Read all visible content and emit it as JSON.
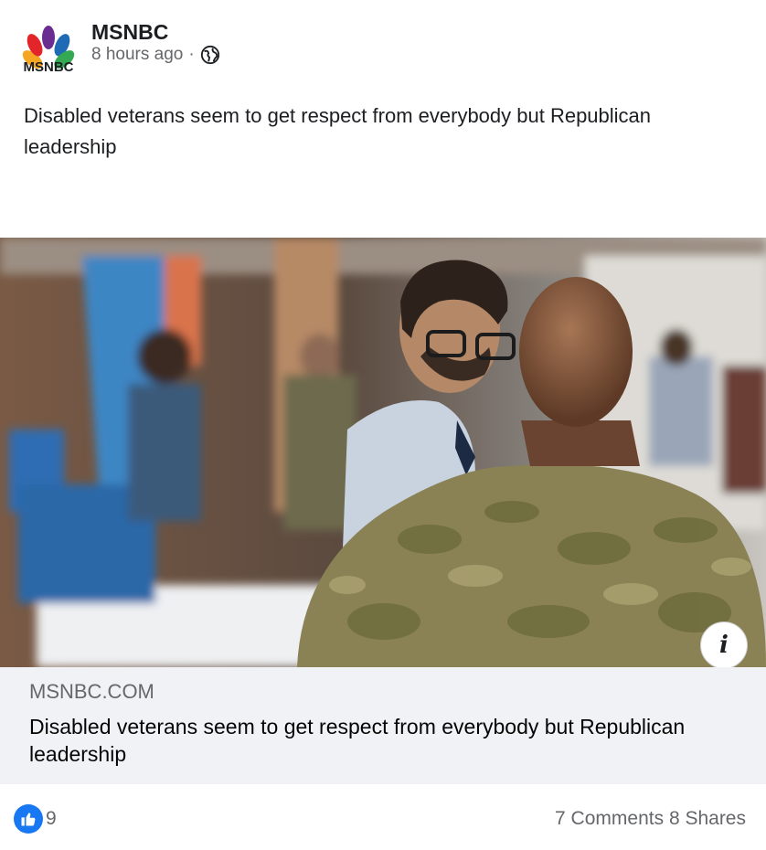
{
  "post": {
    "page_name": "MSNBC",
    "timestamp": "8 hours ago",
    "separator": "·",
    "privacy_icon": "globe-icon",
    "text": "Disabled veterans seem to get respect from everybody but Republican leadership"
  },
  "logo": {
    "wordmark": "MSNBC"
  },
  "link_preview": {
    "domain": "MSNBC.COM",
    "title": "Disabled veterans seem to get respect from everybody but Republican leadership",
    "info_icon": "i"
  },
  "footer": {
    "like_count": "9",
    "comments": "7 Comments",
    "shares": "8 Shares"
  },
  "colors": {
    "brand_blue": "#1877f2",
    "secondary_text": "#65676b",
    "link_bg": "#f0f2f5"
  }
}
